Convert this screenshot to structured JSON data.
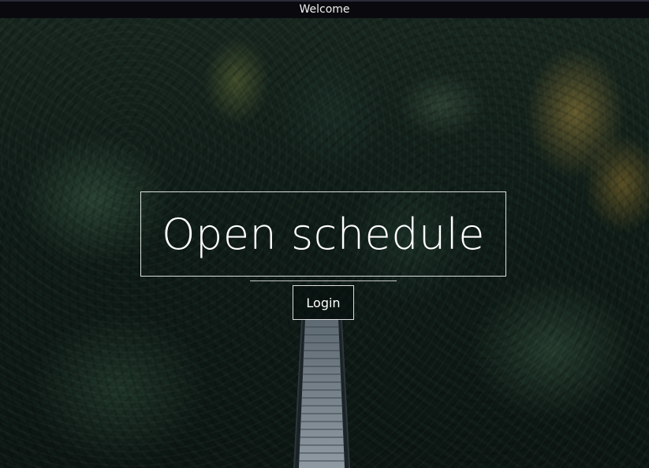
{
  "window": {
    "title": "Welcome"
  },
  "hero": {
    "background_image": "forest-suspension-bridge",
    "headline": "Open schedule",
    "login_label": "Login"
  },
  "colors": {
    "title_bar": "#0a0a0e",
    "text": "#ffffff",
    "forest": "#0f1c17"
  }
}
